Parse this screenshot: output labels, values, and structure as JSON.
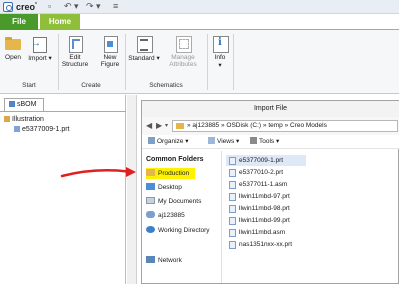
{
  "titlebar": {
    "app_name": "creo",
    "trademark": "°"
  },
  "tabs": {
    "file": "File",
    "home": "Home"
  },
  "ribbon": {
    "open": "Open",
    "import": "Import",
    "edit_structure": [
      "Edit",
      "Structure"
    ],
    "new_figure": [
      "New",
      "Figure"
    ],
    "standard": "Standard",
    "manage_attributes": [
      "Manage",
      "Attributes"
    ],
    "info": "Info",
    "groups": {
      "start": "Start",
      "create": "Create",
      "schematics": "Schematics"
    }
  },
  "left_panel": {
    "tab": "sBOM",
    "tree": [
      {
        "label": "Illustration",
        "kind": "folder",
        "level": 0
      },
      {
        "label": "e5377009-1.prt",
        "kind": "part",
        "level": 1
      }
    ]
  },
  "dialog": {
    "title": "Import File",
    "address_segments": [
      "aj123885",
      "OSDisk (C:)",
      "temp",
      "Creo Models"
    ],
    "toolbar": {
      "organize": "Organize",
      "views": "Views",
      "tools": "Tools"
    },
    "nav": {
      "header": "Common Folders",
      "items": [
        {
          "label": "Production",
          "icon": "folder-icon",
          "highlight": true
        },
        {
          "label": "Desktop",
          "icon": "desktop-icon"
        },
        {
          "label": "My Documents",
          "icon": "documents-icon"
        },
        {
          "label": "aj123885",
          "icon": "user-icon"
        },
        {
          "label": "Working Directory",
          "icon": "working-directory-icon"
        },
        {
          "label": "Network",
          "icon": "network-icon"
        }
      ]
    },
    "files": [
      {
        "name": "e5377009-1.prt",
        "selected": true
      },
      {
        "name": "e5377010-2.prt"
      },
      {
        "name": "e5377011-1.asm"
      },
      {
        "name": "llwin11mbd-97.prt"
      },
      {
        "name": "llwin11mbd-98.prt"
      },
      {
        "name": "llwin11mbd-99.prt"
      },
      {
        "name": "llwin11mbd.asm"
      },
      {
        "name": "nas1351nxx-xx.prt"
      }
    ]
  },
  "colors": {
    "file_tab": "#4a9a2b",
    "home_tab": "#8fbf3a",
    "highlight": "#fff200",
    "arrow": "#e02020"
  }
}
